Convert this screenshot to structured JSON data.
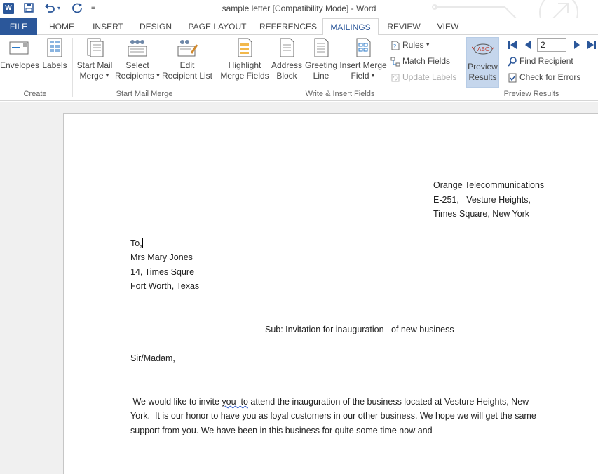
{
  "titlebar": {
    "title": "sample letter [Compatibility Mode] - Word",
    "app_icon_letter": "W"
  },
  "tabs": [
    {
      "label": "FILE"
    },
    {
      "label": "HOME"
    },
    {
      "label": "INSERT"
    },
    {
      "label": "DESIGN"
    },
    {
      "label": "PAGE LAYOUT"
    },
    {
      "label": "REFERENCES"
    },
    {
      "label": "MAILINGS",
      "active": true
    },
    {
      "label": "REVIEW"
    },
    {
      "label": "VIEW"
    }
  ],
  "ribbon": {
    "create": {
      "label": "Create",
      "envelopes": "Envelopes",
      "labels": "Labels"
    },
    "start_mail_merge": {
      "label": "Start Mail Merge",
      "start_mail_merge_l1": "Start Mail",
      "start_mail_merge_l2": "Merge",
      "select_recipients_l1": "Select",
      "select_recipients_l2": "Recipients",
      "edit_recipient_l1": "Edit",
      "edit_recipient_l2": "Recipient List"
    },
    "write_insert": {
      "label": "Write & Insert Fields",
      "highlight_l1": "Highlight",
      "highlight_l2": "Merge Fields",
      "address_l1": "Address",
      "address_l2": "Block",
      "greeting_l1": "Greeting",
      "greeting_l2": "Line",
      "insert_field_l1": "Insert Merge",
      "insert_field_l2": "Field",
      "rules": "Rules",
      "match_fields": "Match Fields",
      "update_labels": "Update Labels"
    },
    "preview": {
      "label": "Preview Results",
      "preview_l1": "Preview",
      "preview_l2": "Results",
      "record_value": "2",
      "find_recipient": "Find Recipient",
      "check_errors": "Check for Errors"
    }
  },
  "document": {
    "sender": [
      "Orange Telecommunications",
      "E-251,   Vesture Heights,",
      "Times Square, New York"
    ],
    "to": "To,",
    "recipient": [
      "Mrs Mary Jones",
      "14, Times Squre",
      "Fort Worth, Texas"
    ],
    "subject": "Sub: Invitation for inauguration   of new business",
    "salutation": "Sir/Madam,",
    "body_l1_a": " We would like to invite ",
    "body_l1_squig": "you  to",
    "body_l1_b": " attend the inauguration of the business located at Vesture Heights, New",
    "body_l2": "York.  It is our honor to have you as loyal customers in our other business. We hope we will get the same",
    "body_l3": "support from you. We have been in this business for quite some time now and"
  },
  "colors": {
    "accent": "#2b579a",
    "preview_active": "#c5d6ec"
  }
}
